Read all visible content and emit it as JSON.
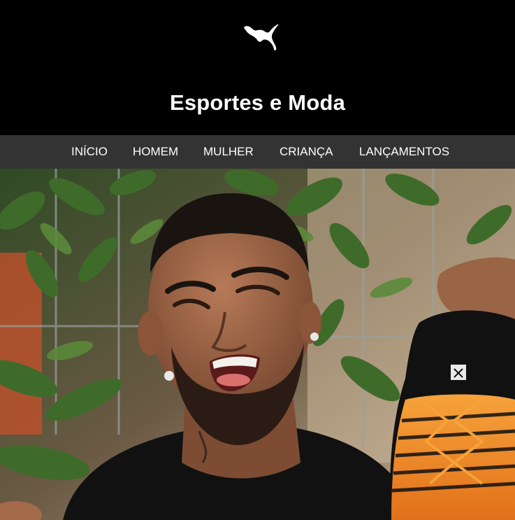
{
  "header": {
    "logo_icon": "puma-cat-icon",
    "title": "Esportes e Moda"
  },
  "nav": {
    "items": [
      {
        "label": "INÍCIO"
      },
      {
        "label": "HOMEM"
      },
      {
        "label": "MULHER"
      },
      {
        "label": "CRIANÇA"
      },
      {
        "label": "LANÇAMENTOS"
      }
    ]
  },
  "hero": {
    "image_icon": "hero-photo",
    "colors": {
      "accent_orange": "#f08a1c",
      "foliage_green": "#3f6b2a",
      "nav_bar": "#333333"
    }
  }
}
